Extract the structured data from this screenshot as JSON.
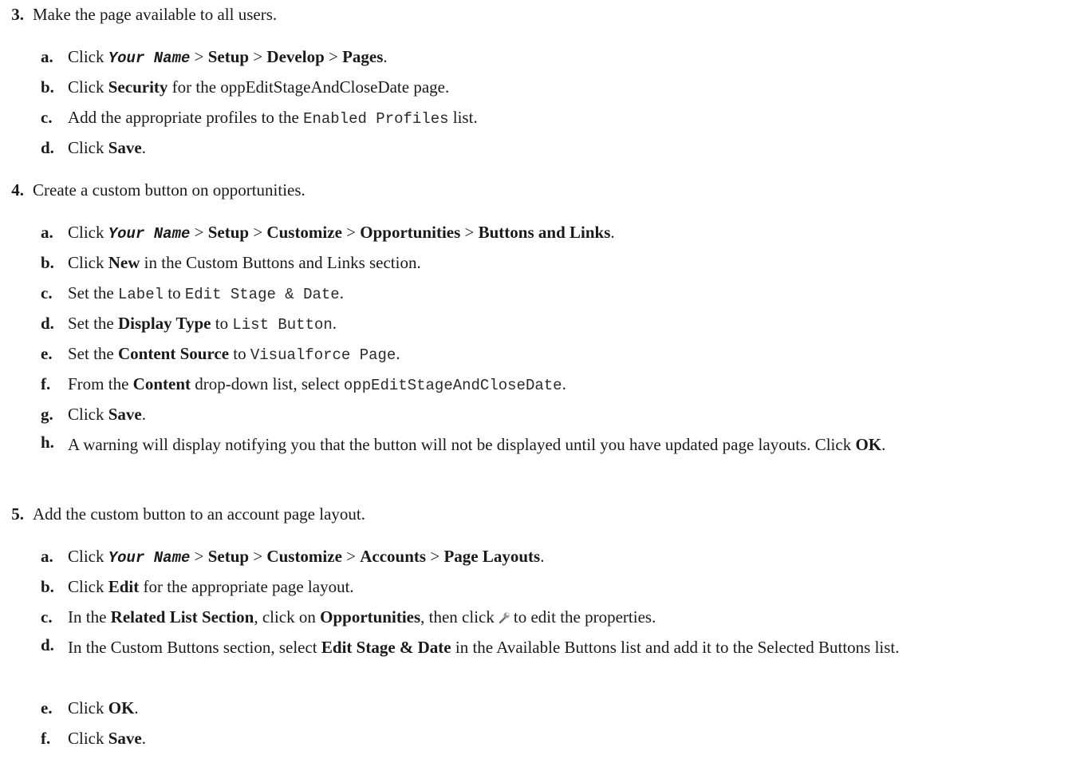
{
  "s3": {
    "num": "3.",
    "text": "Make the page available to all users.",
    "a": {
      "lt": "a.",
      "click": "Click",
      "your_name": "Your Name",
      "sep": ">",
      "p1": "Setup",
      "p2": "Develop",
      "p3": "Pages",
      "end": "."
    },
    "b": {
      "lt": "b.",
      "click": "Click",
      "bold": "Security",
      "rest": "for the oppEditStageAndCloseDate page."
    },
    "c": {
      "lt": "c.",
      "pre": "Add the appropriate profiles to the",
      "code": "Enabled Profiles",
      "post": "list."
    },
    "d": {
      "lt": "d.",
      "click": "Click",
      "bold": "Save",
      "end": "."
    }
  },
  "s4": {
    "num": "4.",
    "text": "Create a custom button on opportunities.",
    "a": {
      "lt": "a.",
      "click": "Click",
      "your_name": "Your Name",
      "sep": ">",
      "p1": "Setup",
      "p2": "Customize",
      "p3": "Opportunities",
      "p4": "Buttons and Links",
      "end": "."
    },
    "b": {
      "lt": "b.",
      "click": "Click",
      "bold": "New",
      "rest": "in the Custom Buttons and Links section."
    },
    "c": {
      "lt": "c.",
      "pre": "Set the",
      "code1": "Label",
      "mid": "to",
      "code2": "Edit Stage & Date",
      "end": "."
    },
    "d": {
      "lt": "d.",
      "pre": "Set the",
      "bold": "Display Type",
      "mid": "to",
      "code": "List Button",
      "end": "."
    },
    "e": {
      "lt": "e.",
      "pre": "Set the",
      "bold": "Content Source",
      "mid": "to",
      "code": "Visualforce Page",
      "end": "."
    },
    "f": {
      "lt": "f.",
      "pre": "From the",
      "bold": "Content",
      "mid": "drop-down list, select",
      "code": "oppEditStageAndCloseDate",
      "end": "."
    },
    "g": {
      "lt": "g.",
      "click": "Click",
      "bold": "Save",
      "end": "."
    },
    "h": {
      "lt": "h.",
      "text": "A warning will display notifying you that the button will not be displayed until you have updated page layouts. Click",
      "bold": "OK",
      "end": "."
    }
  },
  "s5": {
    "num": "5.",
    "text": "Add the custom button to an account page layout.",
    "a": {
      "lt": "a.",
      "click": "Click",
      "your_name": "Your Name",
      "sep": ">",
      "p1": "Setup",
      "p2": "Customize",
      "p3": "Accounts",
      "p4": "Page Layouts",
      "end": "."
    },
    "b": {
      "lt": "b.",
      "click": "Click",
      "bold": "Edit",
      "rest": "for the appropriate page layout."
    },
    "c": {
      "lt": "c.",
      "pre": "In the",
      "bold1": "Related List Section",
      "mid": ", click on",
      "bold2": "Opportunities",
      "mid2": ", then click",
      "icon": "wrench-icon",
      "post": "to edit the properties."
    },
    "d": {
      "lt": "d.",
      "pre": "In the Custom Buttons section, select",
      "bold": "Edit Stage & Date",
      "post": "in the Available Buttons list and add it to the Selected Buttons list."
    },
    "e": {
      "lt": "e.",
      "click": "Click",
      "bold": "OK",
      "end": "."
    },
    "f": {
      "lt": "f.",
      "click": "Click",
      "bold": "Save",
      "end": "."
    }
  }
}
